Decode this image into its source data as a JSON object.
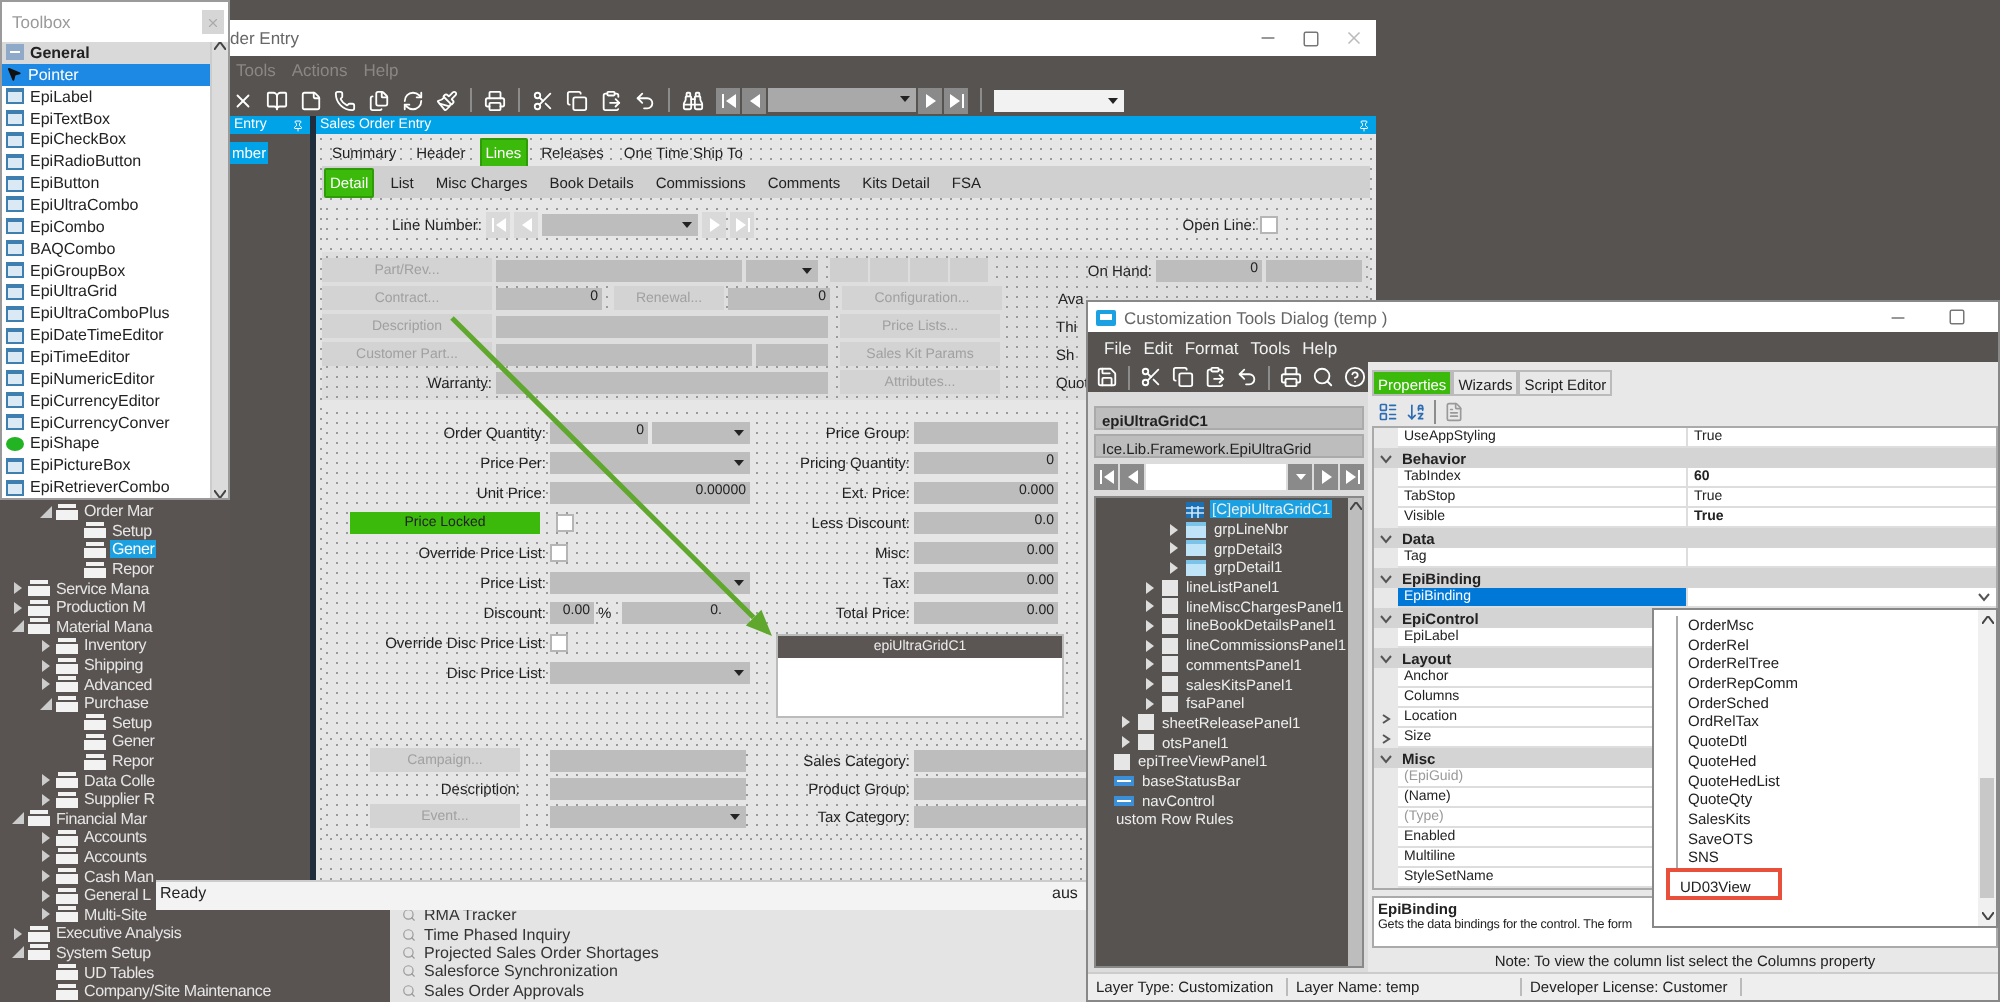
{
  "toolbox": {
    "title": "Toolbox",
    "group": "General",
    "items": [
      {
        "label": "Pointer",
        "kind": "pointer",
        "selected": true
      },
      {
        "label": "EpiLabel",
        "kind": "control",
        "selected": false
      },
      {
        "label": "EpiTextBox",
        "kind": "control",
        "selected": false
      },
      {
        "label": "EpiCheckBox",
        "kind": "control",
        "selected": false
      },
      {
        "label": "EpiRadioButton",
        "kind": "control",
        "selected": false
      },
      {
        "label": "EpiButton",
        "kind": "control",
        "selected": false
      },
      {
        "label": "EpiUltraCombo",
        "kind": "control",
        "selected": false
      },
      {
        "label": "EpiCombo",
        "kind": "control",
        "selected": false
      },
      {
        "label": "BAQCombo",
        "kind": "control",
        "selected": false
      },
      {
        "label": "EpiGroupBox",
        "kind": "control",
        "selected": false
      },
      {
        "label": "EpiUltraGrid",
        "kind": "control",
        "selected": false
      },
      {
        "label": "EpiUltraComboPlus",
        "kind": "control",
        "selected": false
      },
      {
        "label": "EpiDateTimeEditor",
        "kind": "control",
        "selected": false
      },
      {
        "label": "EpiTimeEditor",
        "kind": "control",
        "selected": false
      },
      {
        "label": "EpiNumericEditor",
        "kind": "control",
        "selected": false
      },
      {
        "label": "EpiCurrencyEditor",
        "kind": "control",
        "selected": false
      },
      {
        "label": "EpiCurrencyConver",
        "kind": "control",
        "selected": false
      },
      {
        "label": "EpiShape",
        "kind": "shape",
        "selected": false
      },
      {
        "label": "EpiPictureBox",
        "kind": "control",
        "selected": false
      },
      {
        "label": "EpiRetrieverCombo",
        "kind": "control",
        "selected": false
      }
    ]
  },
  "menu_tree": [
    {
      "children": [
        {
          "label": "Order Mar",
          "expanded": true,
          "selected": false,
          "children": [
            {
              "label": "Setup",
              "selected": false
            },
            {
              "label": "Gener",
              "selected": true
            },
            {
              "label": "Repor",
              "selected": false
            }
          ]
        }
      ]
    },
    {
      "label": "Service Mana",
      "expanded": false,
      "selected": false
    },
    {
      "label": "Production M",
      "expanded": false,
      "selected": false
    },
    {
      "label": "Material Mana",
      "expanded": true,
      "selected": false,
      "children": [
        {
          "label": "Inventory",
          "expanded": false,
          "selected": false
        },
        {
          "label": "Shipping",
          "expanded": false,
          "selected": false
        },
        {
          "label": "Advanced",
          "expanded": false,
          "selected": false
        },
        {
          "label": "Purchase",
          "expanded": true,
          "selected": false,
          "children": [
            {
              "label": "Setup",
              "selected": false
            },
            {
              "label": "Gener",
              "selected": false
            },
            {
              "label": "Repor",
              "selected": false
            }
          ]
        },
        {
          "label": "Data Colle",
          "expanded": false,
          "selected": false
        },
        {
          "label": "Supplier R",
          "expanded": false,
          "selected": false
        }
      ]
    },
    {
      "label": "Financial Mar",
      "expanded": true,
      "selected": false,
      "children": [
        {
          "label": "Accounts",
          "expanded": false,
          "selected": false
        },
        {
          "label": "Accounts",
          "expanded": false,
          "selected": false
        },
        {
          "label": "Cash Man",
          "expanded": false,
          "selected": false
        },
        {
          "label": "General L",
          "expanded": false,
          "selected": false
        },
        {
          "label": "Multi-Site",
          "expanded": false,
          "selected": false
        }
      ]
    },
    {
      "label": "Executive Analysis",
      "expanded": false,
      "selected": false
    },
    {
      "label": "System Setup",
      "expanded": true,
      "selected": false,
      "children": [
        {
          "label": "UD Tables",
          "selected": false
        },
        {
          "label": "Company/Site Maintenance",
          "selected": false
        }
      ]
    }
  ],
  "menu_list": [
    "RMA Tracker",
    "Time Phased Inquiry",
    "Projected Sales Order Shortages",
    "Salesforce Synchronization",
    "Sales Order Approvals"
  ],
  "order_entry": {
    "title": "der Entry",
    "menu": [
      "Tools",
      "Actions",
      "Help"
    ],
    "nav_panel": {
      "title": "Entry",
      "items": [
        {
          "label": "mber",
          "selected": true
        }
      ]
    },
    "panel_title": "Sales Order Entry",
    "tabs": [
      {
        "label": "Summary",
        "selected": false
      },
      {
        "label": "Header",
        "selected": false
      },
      {
        "label": "Lines",
        "selected": true
      },
      {
        "label": "Releases",
        "selected": false
      },
      {
        "label": "One Time Ship To",
        "selected": false
      }
    ],
    "subtabs": [
      {
        "label": "Detail",
        "selected": true
      },
      {
        "label": "List",
        "selected": false
      },
      {
        "label": "Misc Charges",
        "selected": false
      },
      {
        "label": "Book Details",
        "selected": false
      },
      {
        "label": "Commissions",
        "selected": false
      },
      {
        "label": "Comments",
        "selected": false
      },
      {
        "label": "Kits Detail",
        "selected": false
      },
      {
        "label": "FSA",
        "selected": false
      }
    ],
    "line_number": {
      "label": "Line Number:",
      "open_line": {
        "label": "Open Line:",
        "checked": false
      }
    },
    "part": {
      "part_rev": {
        "label": "Part/Rev...",
        "disabled": true
      },
      "on_hand_label": "On Hand:",
      "on_hand_value": "0",
      "contract": {
        "label": "Contract...",
        "disabled": true
      },
      "contract_value": "0",
      "renewal": {
        "label": "Renewal...",
        "disabled": true
      },
      "renewal_value": "0",
      "configuration": {
        "label": "Configuration...",
        "disabled": true
      },
      "available_label": "Ava",
      "description": {
        "label": "Description",
        "disabled": true
      },
      "price_lists": {
        "label": "Price Lists...",
        "disabled": true
      },
      "third_label": "Thi",
      "customer_part": {
        "label": "Customer Part...",
        "disabled": true
      },
      "sales_kit_params": {
        "label": "Sales Kit Params",
        "disabled": true
      },
      "ship_label": "Sh",
      "warranty_label": "Warranty:",
      "attributes": {
        "label": "Attributes...",
        "disabled": true
      },
      "quote_label": "Quot"
    },
    "pricing": {
      "left": [
        {
          "kind": "quantity",
          "label": "Order Quantity:",
          "value": "0"
        },
        {
          "kind": "combo",
          "label": "Price Per:"
        },
        {
          "kind": "field",
          "label": "Unit Price:",
          "value": "0.00000"
        },
        {
          "kind": "status",
          "label": "Price Locked",
          "checked": false
        },
        {
          "kind": "checkbox",
          "label": "Override Price List:",
          "checked": false
        },
        {
          "kind": "combo",
          "label": "Price List:"
        },
        {
          "kind": "discount",
          "label": "Discount:",
          "percent": "0.00",
          "unit": "%",
          "value": "0."
        },
        {
          "kind": "checkbox",
          "label": "Override Disc Price List:",
          "checked": false
        },
        {
          "kind": "combo",
          "label": "Disc Price List:"
        }
      ],
      "right": [
        {
          "label": "Price Group:"
        },
        {
          "label": "Pricing Quantity:",
          "value": "0"
        },
        {
          "label": "Ext. Price:",
          "value": "0.000"
        },
        {
          "label": "Less Discount:",
          "value": "0.0"
        },
        {
          "label": "Misc:",
          "value": "0.00"
        },
        {
          "label": "Tax:",
          "value": "0.00"
        },
        {
          "label": "Total Price:",
          "value": "0.00"
        }
      ],
      "grid_title": "epiUltraGridC1"
    },
    "bottom": {
      "left": [
        {
          "kind": "button",
          "label": "Campaign...",
          "disabled": true
        },
        {
          "kind": "label",
          "label": "Description:"
        },
        {
          "kind": "combo_button",
          "label": "Event...",
          "disabled": true
        }
      ],
      "right": [
        "Sales Category:",
        "Product Group:",
        "Tax Category:"
      ]
    },
    "status": "Ready",
    "status_right": "aus"
  },
  "customization": {
    "title": "Customization Tools Dialog  (temp )",
    "menu": [
      "File",
      "Edit",
      "Format",
      "Tools",
      "Help"
    ],
    "control_name": "epiUltraGridC1",
    "control_type": "Ice.Lib.Framework.EpiUltraGrid",
    "tree": [
      {
        "children": [
          {
            "children": [
              {
                "children": [
                  {
                    "label": "[C]epiUltraGridC1",
                    "kind": "grid",
                    "selected": true
                  },
                  {
                    "label": "grpLineNbr",
                    "kind": "group",
                    "expanded": false,
                    "selected": false
                  },
                  {
                    "label": "grpDetail3",
                    "kind": "group",
                    "expanded": false,
                    "selected": false
                  },
                  {
                    "label": "grpDetail1",
                    "kind": "group",
                    "expanded": false,
                    "selected": false
                  }
                ]
              },
              {
                "label": "lineListPanel1",
                "kind": "panel",
                "expanded": false,
                "selected": false
              },
              {
                "label": "lineMiscChargesPanel1",
                "kind": "panel",
                "expanded": false,
                "selected": false
              },
              {
                "label": "lineBookDetailsPanel1",
                "kind": "panel",
                "expanded": false,
                "selected": false
              },
              {
                "label": "lineCommissionsPanel1",
                "kind": "panel",
                "expanded": false,
                "selected": false
              },
              {
                "label": "commentsPanel1",
                "kind": "panel",
                "expanded": false,
                "selected": false
              },
              {
                "label": "salesKitsPanel1",
                "kind": "panel",
                "expanded": false,
                "selected": false
              },
              {
                "label": "fsaPanel",
                "kind": "panel",
                "expanded": false,
                "selected": false
              }
            ]
          },
          {
            "label": "sheetReleasePanel1",
            "kind": "panel",
            "expanded": false,
            "selected": false
          },
          {
            "label": "otsPanel1",
            "kind": "panel",
            "expanded": false,
            "selected": false
          }
        ]
      },
      {
        "label": "epiTreeViewPanel1",
        "kind": "panel",
        "selected": false
      },
      {
        "label": "baseStatusBar",
        "kind": "bar",
        "selected": false
      },
      {
        "label": "navControl",
        "kind": "bar",
        "selected": false
      },
      {
        "label": "ustom Row Rules",
        "kind": "text",
        "selected": false
      }
    ],
    "tabs": [
      {
        "label": "Properties",
        "selected": true
      },
      {
        "label": "Wizards",
        "selected": false
      },
      {
        "label": "Script Editor",
        "selected": false
      }
    ],
    "properties": [
      {
        "kind": "property",
        "name": "UseAppStyling",
        "value": "True",
        "bold": false,
        "dimmed": false,
        "selected": false
      },
      {
        "kind": "category",
        "name": "Behavior",
        "expanded": true
      },
      {
        "kind": "property",
        "name": "TabIndex",
        "value": "60",
        "bold": true,
        "dimmed": false,
        "selected": false
      },
      {
        "kind": "property",
        "name": "TabStop",
        "value": "True",
        "bold": false,
        "dimmed": false,
        "selected": false
      },
      {
        "kind": "property",
        "name": "Visible",
        "value": "True",
        "bold": true,
        "dimmed": false,
        "selected": false
      },
      {
        "kind": "category",
        "name": "Data",
        "expanded": true
      },
      {
        "kind": "property",
        "name": "Tag",
        "dimmed": false,
        "selected": false
      },
      {
        "kind": "category",
        "name": "EpiBinding",
        "expanded": true
      },
      {
        "kind": "property",
        "name": "EpiBinding",
        "dimmed": false,
        "selected": true,
        "dropdown": true
      },
      {
        "kind": "category",
        "name": "EpiControl",
        "expanded": true
      },
      {
        "kind": "property",
        "name": "EpiLabel",
        "dimmed": false,
        "selected": false
      },
      {
        "kind": "category",
        "name": "Layout",
        "expanded": true
      },
      {
        "kind": "property",
        "name": "Anchor",
        "dimmed": false,
        "selected": false
      },
      {
        "kind": "property",
        "name": "Columns",
        "dimmed": false,
        "selected": false
      },
      {
        "kind": "property",
        "name": "Location",
        "dimmed": false,
        "selected": false,
        "expanded": false
      },
      {
        "kind": "property",
        "name": "Size",
        "dimmed": false,
        "selected": false,
        "expanded": false
      },
      {
        "kind": "category",
        "name": "Misc",
        "expanded": true
      },
      {
        "kind": "property",
        "name": "(EpiGuid)",
        "dimmed": true,
        "selected": false
      },
      {
        "kind": "property",
        "name": "(Name)",
        "dimmed": false,
        "selected": false
      },
      {
        "kind": "property",
        "name": "(Type)",
        "dimmed": true,
        "selected": false
      },
      {
        "kind": "property",
        "name": "Enabled",
        "dimmed": false,
        "selected": false
      },
      {
        "kind": "property",
        "name": "Multiline",
        "dimmed": false,
        "selected": false
      },
      {
        "kind": "property",
        "name": "StyleSetName",
        "dimmed": false,
        "selected": false
      }
    ],
    "dropdown": [
      {
        "label": "OrderMsc",
        "highlighted": false
      },
      {
        "label": "OrderRel",
        "highlighted": false
      },
      {
        "label": "OrderRelTree",
        "highlighted": false
      },
      {
        "label": "OrderRepComm",
        "highlighted": false
      },
      {
        "label": "OrderSched",
        "highlighted": false
      },
      {
        "label": "OrdRelTax",
        "highlighted": false
      },
      {
        "label": "QuoteDtl",
        "highlighted": false
      },
      {
        "label": "QuoteHed",
        "highlighted": false
      },
      {
        "label": "QuoteHedList",
        "highlighted": false
      },
      {
        "label": "QuoteQty",
        "highlighted": false
      },
      {
        "label": "SalesKits",
        "highlighted": false
      },
      {
        "label": "SaveOTS",
        "highlighted": false
      },
      {
        "label": "SNS",
        "highlighted": false
      },
      {
        "label": "UD03View",
        "highlighted": true
      }
    ],
    "help": {
      "title": "EpiBinding",
      "text": "Gets the data bindings for the control. The form"
    },
    "note": "Note:  To view the column list select the Columns property",
    "status": [
      "Layer Type:  Customization",
      "Layer Name:  temp",
      "Developer License:  Customer"
    ]
  }
}
